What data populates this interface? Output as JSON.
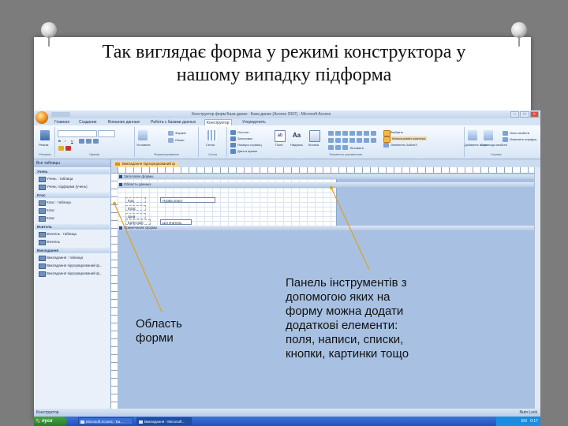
{
  "slide": {
    "title_lines": [
      "Так виглядає форма у режимі конструктора у",
      "нашому випадку підформа"
    ]
  },
  "window": {
    "title": "Конструктор форм    База даних : База даних (Access 2007) - Microsoft Access",
    "context_tab": "Конструктор форм"
  },
  "ribbon": {
    "tabs": [
      "Главная",
      "Создание",
      "Внешние данные",
      "Работа с базами данных",
      "Конструктор",
      "Упорядочить"
    ],
    "groups": [
      {
        "label": "Режимы",
        "buttons": [
          "Режим"
        ]
      },
      {
        "label": "Шрифт",
        "buttons": [
          "B",
          "I",
          "U"
        ]
      },
      {
        "label": "Форматирование",
        "buttons": [
          "Условное",
          "Формат",
          "Линии"
        ]
      },
      {
        "label": "Сетка",
        "buttons": [
          "Сетка"
        ]
      },
      {
        "label": "Элементы управления",
        "buttons": [
          "Логотип",
          "Заголовок",
          "Номера страниц",
          "Дата и время",
          "Поле",
          "Надпись",
          "Кнопка",
          "Вставить"
        ]
      },
      {
        "label": "Сервис",
        "buttons": [
          "Добавить поля",
          "Страница свойств",
          "Окно свойств",
          "Изменить порядок"
        ]
      }
    ],
    "tools_row1": [
      "Выбрать",
      "Использовать мастера"
    ],
    "tools_row2": [
      "Элементы ActiveX"
    ]
  },
  "nav": {
    "header": "Все таблицы",
    "sections": [
      {
        "title": "Учень",
        "items": [
          "Учень : таблица",
          "Учень: підформа (учень)"
        ]
      },
      {
        "title": "Клас",
        "items": [
          "Клас : таблица",
          "Клас",
          "Клас"
        ]
      },
      {
        "title": "Вчитель",
        "items": [
          "Вчитель : таблица",
          "Вчитель"
        ]
      },
      {
        "title": "Викладання",
        "items": [
          "Викладання : таблица",
          "Викладання підпорядкований ф...",
          "Викладання підпорядкований ф..."
        ]
      }
    ]
  },
  "designer": {
    "doc_tab": "Викладання підпорядкований ф",
    "section_header": "Заголовок формы",
    "section_detail": "Область данных",
    "section_footer": "Примечание формы",
    "controls": [
      {
        "label": "Код",
        "field": "Назва класу"
      },
      {
        "label": "Клас",
        "field": ""
      },
      {
        "label": "Ціна",
        "field": ""
      },
      {
        "label": "Категорія",
        "field": "Ціл вчитель"
      }
    ]
  },
  "status": {
    "left": "Конструктор",
    "right": "Num Lock"
  },
  "taskbar": {
    "start": "пуск",
    "tasks": [
      "Microsoft Access - Ба...",
      "Викладання - Microsoft..."
    ],
    "tray_lang": "EN",
    "tray_time": "0:17"
  },
  "annotations": {
    "form_area_lines": [
      "Область",
      "форми"
    ],
    "toolbar_lines": [
      "Панель інструментів з",
      "допомогою яких на",
      "форму можна додати",
      "додаткові елементи:",
      "поля, написи, списки,",
      "кнопки, картинки тощо"
    ]
  },
  "colors": {
    "slide_background": "#7c7c7c",
    "leader_line": "#e0a020",
    "designer_canvas": "#a8c1e2"
  }
}
